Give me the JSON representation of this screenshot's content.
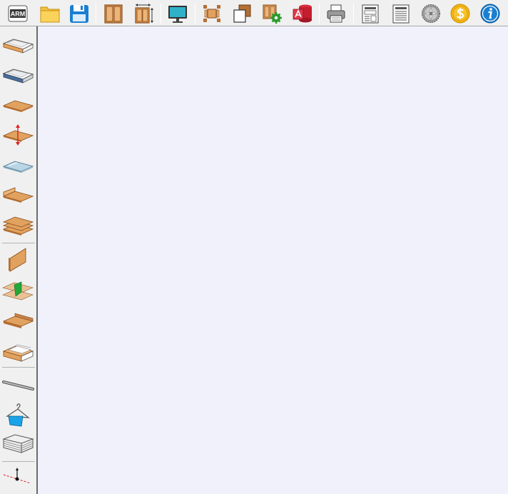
{
  "toolbar": {
    "arm_logo_text": "ARM",
    "items": [
      {
        "icon": "arm-logo-icon"
      },
      {
        "icon": "open-folder-icon"
      },
      {
        "icon": "save-disk-icon"
      },
      {
        "icon": "cabinet-doors-icon"
      },
      {
        "icon": "cabinet-dimensions-icon"
      },
      {
        "icon": "monitor-icon"
      },
      {
        "icon": "cabinet-transform-icon"
      },
      {
        "icon": "copy-panels-icon"
      },
      {
        "icon": "cabinet-settings-icon"
      },
      {
        "icon": "access-database-icon"
      },
      {
        "icon": "printer-icon"
      },
      {
        "icon": "report-table-icon"
      },
      {
        "icon": "report-list-icon"
      },
      {
        "icon": "saw-blade-icon"
      },
      {
        "icon": "dollar-coin-icon"
      },
      {
        "icon": "info-icon"
      }
    ]
  },
  "sidebar": {
    "groups": [
      {
        "items": [
          {
            "icon": "drawer-white-icon"
          },
          {
            "icon": "drawer-steel-icon"
          },
          {
            "icon": "shelf-panel-icon"
          },
          {
            "icon": "adjustable-shelf-icon"
          },
          {
            "icon": "glass-shelf-icon"
          },
          {
            "icon": "shelf-with-edge-icon"
          },
          {
            "icon": "stacked-panels-icon"
          }
        ]
      },
      {
        "items": [
          {
            "icon": "vertical-panel-icon"
          },
          {
            "icon": "panel-intersection-icon"
          },
          {
            "icon": "panel-with-lip-icon"
          },
          {
            "icon": "drawer-box-icon"
          }
        ]
      },
      {
        "items": [
          {
            "icon": "hanging-rail-icon"
          },
          {
            "icon": "clothes-hanger-icon"
          },
          {
            "icon": "wire-basket-icon"
          }
        ]
      },
      {
        "items": [
          {
            "icon": "axis-point-icon"
          }
        ]
      }
    ]
  },
  "colors": {
    "canvas_background": "#f1f1fb",
    "wood": "#e1a25f",
    "wood_dark": "#b46f33",
    "accent_blue": "#1a7fd1",
    "folder_yellow": "#f4c142",
    "coin_gold": "#f5b60e"
  }
}
